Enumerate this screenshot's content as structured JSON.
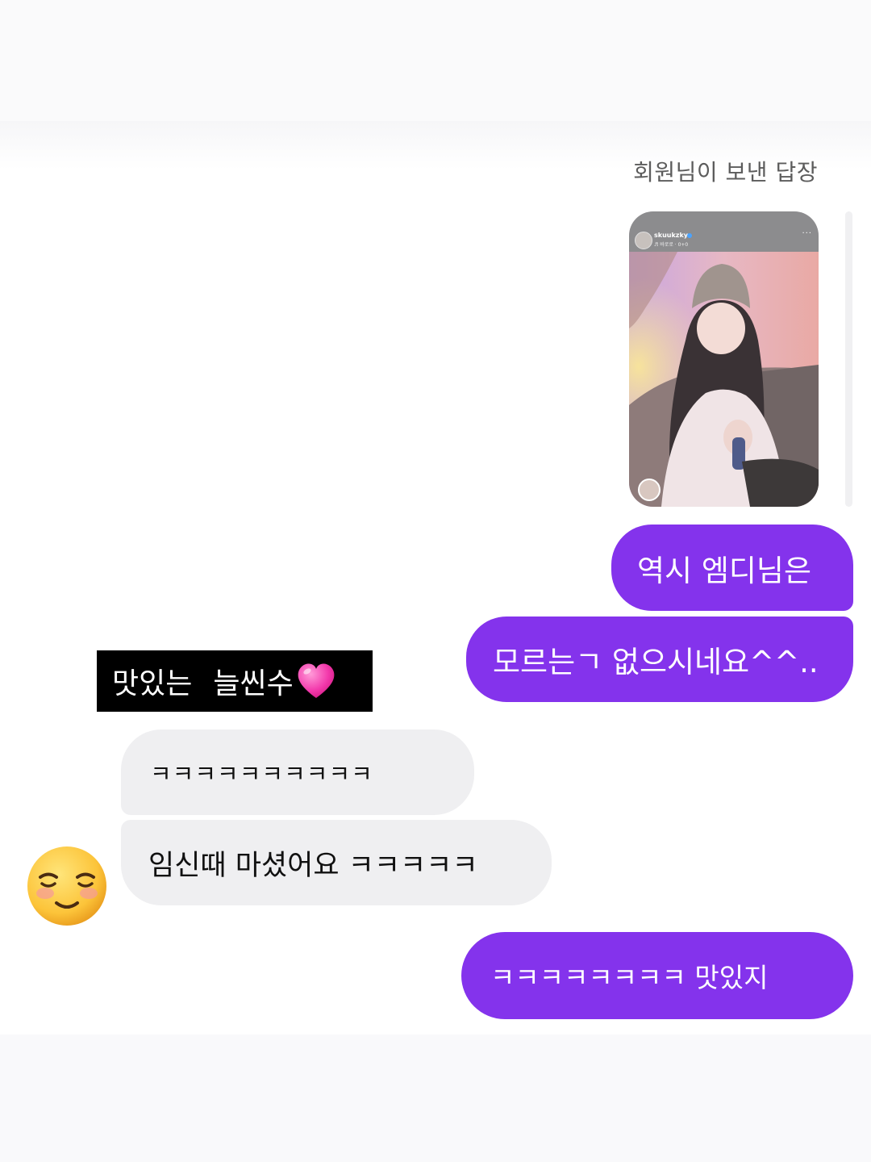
{
  "header": {
    "reply_label": "회원님이 보낸 답장"
  },
  "story_preview": {
    "username": "skuukzky",
    "subtitle": "♬ 바로로 · 0+0",
    "more": "···"
  },
  "messages": [
    {
      "side": "sent",
      "text": "역시 엠디님은"
    },
    {
      "side": "sent",
      "text": "모르는ㄱ 없으시네요^^.."
    },
    {
      "side": "received",
      "text": "ㅋㅋㅋㅋㅋㅋㅋㅋㅋㅋ"
    },
    {
      "side": "received",
      "text": "임신때 마셨어요 ㅋㅋㅋㅋㅋ"
    },
    {
      "side": "sent",
      "text": "ㅋㅋㅋㅋㅋㅋㅋㅋ 맛있지"
    }
  ],
  "sticker": {
    "word1": "맛있는",
    "word2": "늘씬수",
    "icon": "pink-heart-icon"
  },
  "avatar_emoji": "smiling-face-icon",
  "colors": {
    "sent_bubble": "#8433ec",
    "received_bubble": "#efeff1",
    "background": "#ffffff"
  }
}
